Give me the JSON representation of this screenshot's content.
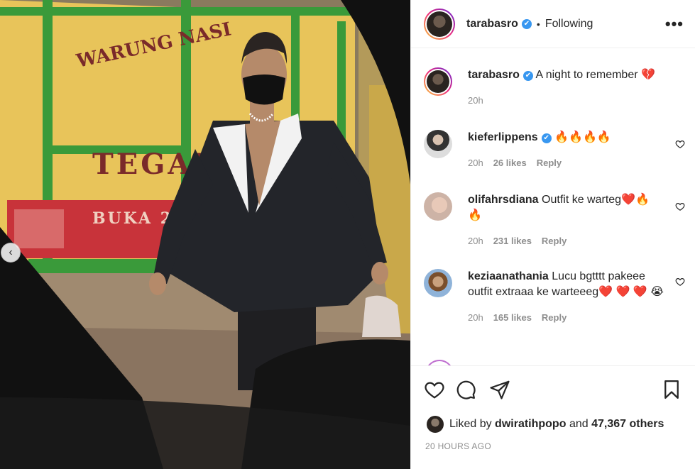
{
  "header": {
    "username": "tarabasro",
    "verified_mark": "✔",
    "separator": "•",
    "follow_status": "Following",
    "more_label": "•••"
  },
  "caption": {
    "username": "tarabasro",
    "text": "A night to remember",
    "emoji": "💔",
    "time": "20h"
  },
  "comments": [
    {
      "username": "kieferlippens",
      "verified": true,
      "text": "🔥🔥🔥🔥",
      "time": "20h",
      "likes": "26 likes",
      "reply": "Reply"
    },
    {
      "username": "olifahrsdiana",
      "verified": false,
      "text": "Outfit ke warteg❤️🔥 🔥",
      "time": "20h",
      "likes": "231 likes",
      "reply": "Reply"
    },
    {
      "username": "keziaanathania",
      "verified": false,
      "text": "Lucu bgtttt pakeee outfit extraaa ke warteeeg❤️ ❤️ ❤️ 😭",
      "time": "20h",
      "likes": "165 likes",
      "reply": "Reply"
    }
  ],
  "actions": {
    "like_icon": "heart-outline-icon",
    "comment_icon": "comment-bubble-icon",
    "share_icon": "paper-plane-icon",
    "save_icon": "bookmark-icon"
  },
  "likes_summary": {
    "prefix": "Liked by",
    "user": "dwiratihpopo",
    "middle": "and",
    "count": "47,367 others"
  },
  "timestamp": "20 HOURS AGO",
  "photo": {
    "sign_line1": "WARUNG NASI",
    "sign_line2": "TEGAL",
    "sign_line3": "BUKA 24"
  },
  "colors": {
    "verified_blue": "#3897f0",
    "text_dark": "#262626",
    "text_muted": "#8e8e8e"
  }
}
